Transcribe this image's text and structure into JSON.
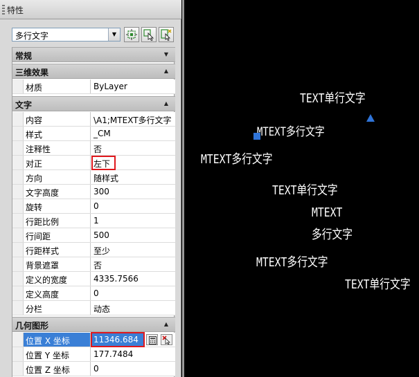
{
  "palette": {
    "title": "特性",
    "selector": {
      "value": "多行文字"
    },
    "sections": {
      "general": "常规",
      "threed": "三维效果",
      "text": "文字",
      "geometry": "几何图形"
    },
    "rows": {
      "material": {
        "name": "材质",
        "value": "ByLayer"
      },
      "contents": {
        "name": "内容",
        "value": "\\A1;MTEXT多行文字"
      },
      "style": {
        "name": "样式",
        "value": "_CM"
      },
      "annotative": {
        "name": "注释性",
        "value": "否"
      },
      "justify": {
        "name": "对正",
        "value": "左下"
      },
      "direction": {
        "name": "方向",
        "value": "随样式"
      },
      "height": {
        "name": "文字高度",
        "value": "300"
      },
      "rotation": {
        "name": "旋转",
        "value": "0"
      },
      "line_spacing_factor": {
        "name": "行距比例",
        "value": "1"
      },
      "line_spacing_distance": {
        "name": "行间距",
        "value": "500"
      },
      "line_spacing_style": {
        "name": "行距样式",
        "value": "至少"
      },
      "background_mask": {
        "name": "背景遮罩",
        "value": "否"
      },
      "defined_width": {
        "name": "定义的宽度",
        "value": "4335.7566"
      },
      "defined_height": {
        "name": "定义高度",
        "value": "0"
      },
      "columns": {
        "name": "分栏",
        "value": "动态"
      },
      "pos_x": {
        "name": "位置 X 坐标",
        "value": "11346.684"
      },
      "pos_y": {
        "name": "位置 Y 坐标",
        "value": "177.7484"
      },
      "pos_z": {
        "name": "位置 Z 坐标",
        "value": "0"
      }
    }
  },
  "canvas": {
    "texts": [
      "TEXT单行文字",
      "MTEXT多行文字",
      "MTEXT多行文字",
      "TEXT单行文字",
      "MTEXT",
      "多行文字",
      "MTEXT多行文字",
      "TEXT单行文字"
    ]
  },
  "colors": {
    "selection": "#3a7fd6",
    "highlight": "#e0171c",
    "grip": "#2f74d8",
    "canvas_bg": "#000000"
  }
}
